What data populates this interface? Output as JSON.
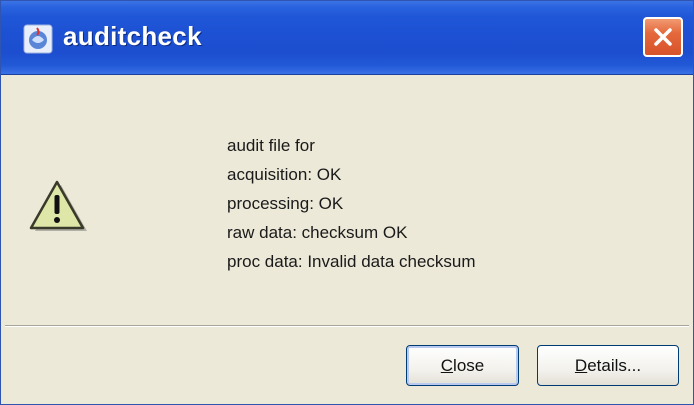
{
  "window": {
    "title": "auditcheck",
    "icon": "java-app-icon"
  },
  "dialog": {
    "icon": "warning-icon",
    "messages": [
      "audit file for",
      "acquisition: OK",
      "processing: OK",
      "raw data: checksum OK",
      "proc data: Invalid data checksum"
    ]
  },
  "buttons": {
    "close_first": "C",
    "close_rest": "lose",
    "details_first": "D",
    "details_rest": "etails..."
  },
  "colors": {
    "titlebar": "#1d51d3",
    "dialog_bg": "#ece9d8",
    "close_button": "#e4683b",
    "warning_fill": "#dfe7a8"
  }
}
